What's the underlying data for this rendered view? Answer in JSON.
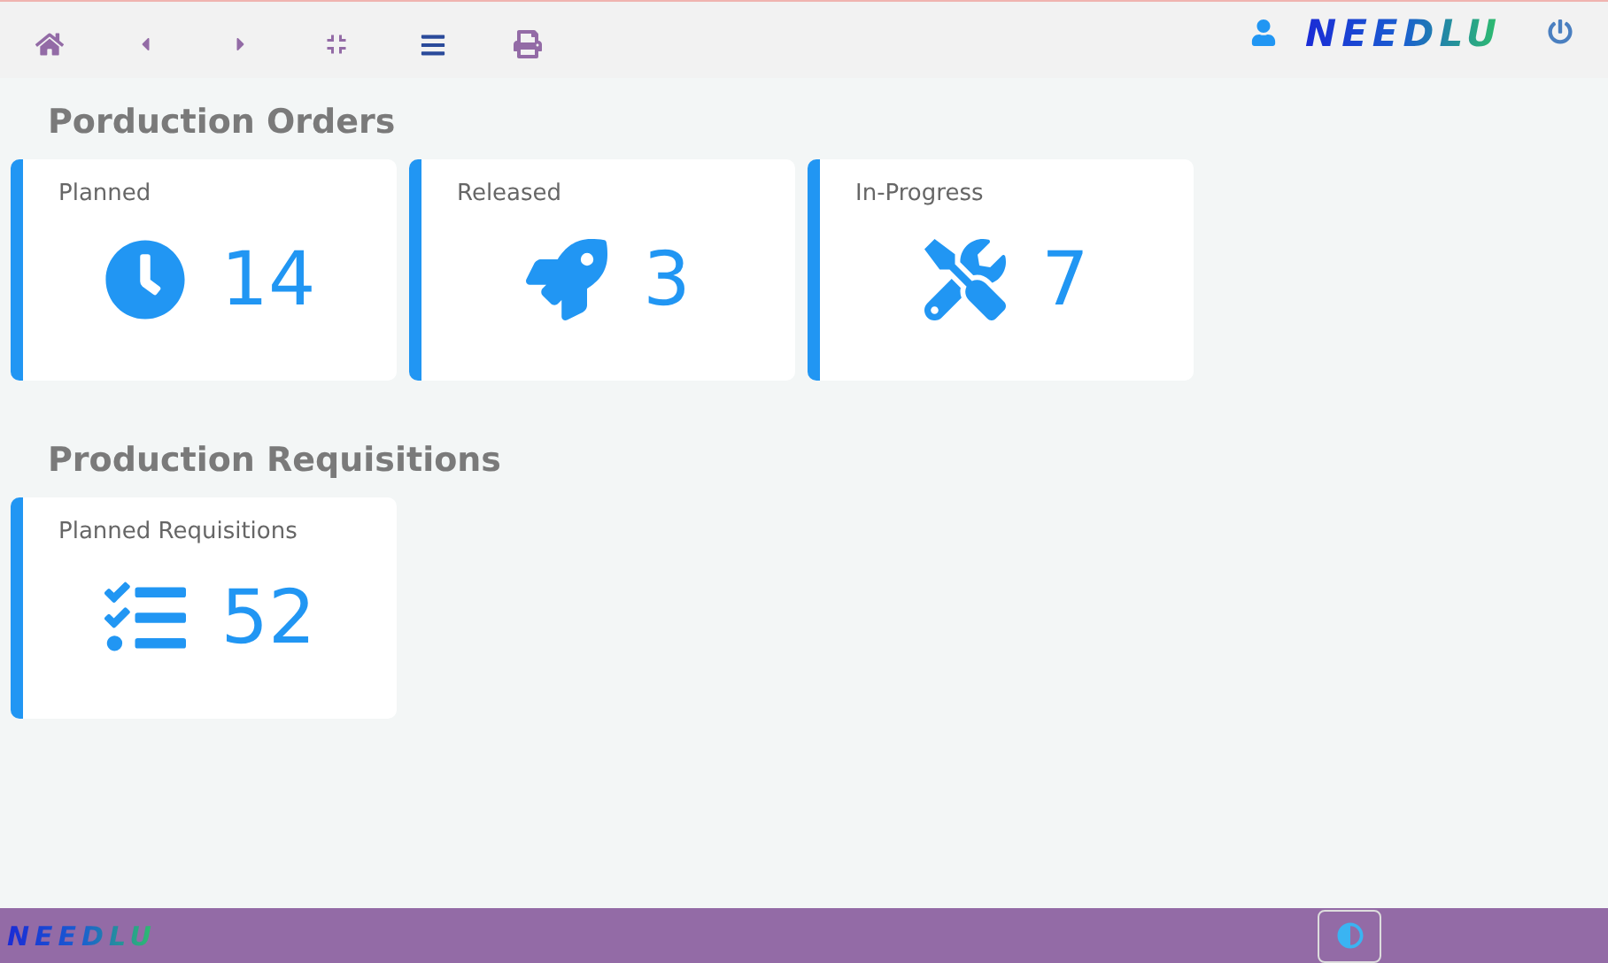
{
  "toolbar": {
    "brand": "NEEDLU",
    "buttons": [
      {
        "kind": "home"
      },
      {
        "kind": "back"
      },
      {
        "kind": "forward"
      },
      {
        "kind": "compress"
      },
      {
        "kind": "menu"
      },
      {
        "kind": "print"
      }
    ]
  },
  "sections": [
    {
      "title": "Porduction Orders",
      "cards": [
        {
          "label": "Planned",
          "value": "14",
          "kind": "clock"
        },
        {
          "label": "Released",
          "value": "3",
          "kind": "rocket"
        },
        {
          "label": "In-Progress",
          "value": "7",
          "kind": "tools"
        }
      ]
    },
    {
      "title": "Production Requisitions",
      "cards": [
        {
          "label": "Planned Requisitions",
          "value": "52",
          "kind": "checklist"
        }
      ]
    }
  ],
  "footer": {
    "brand": "NEEDLU"
  }
}
